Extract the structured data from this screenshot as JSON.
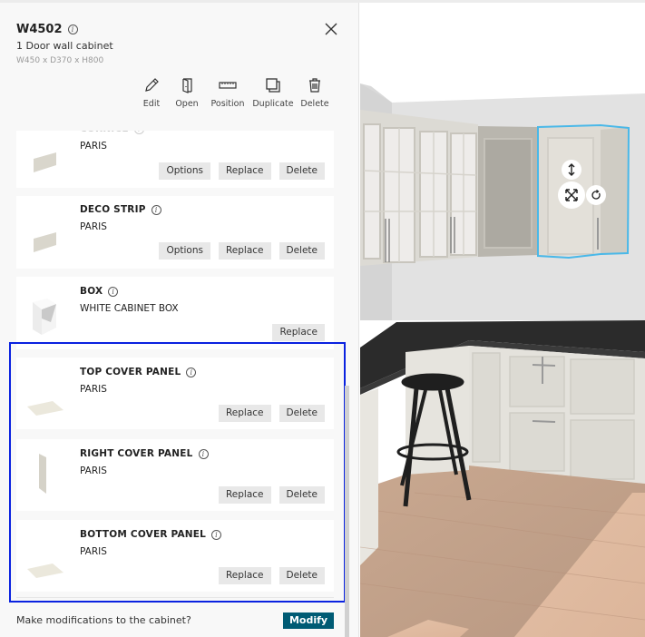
{
  "panel": {
    "title": "W4502",
    "subtitle": "1 Door wall cabinet",
    "dimensions": "W450 x D370 x H800",
    "actions": [
      {
        "label": "Edit",
        "icon": "pencil-icon"
      },
      {
        "label": "Open",
        "icon": "door-icon"
      },
      {
        "label": "Position",
        "icon": "ruler-icon"
      },
      {
        "label": "Duplicate",
        "icon": "duplicate-icon"
      },
      {
        "label": "Delete",
        "icon": "trash-icon"
      }
    ]
  },
  "components": [
    {
      "title": "CORNICE",
      "subtitle": "PARIS",
      "buttons": [
        "Options",
        "Replace",
        "Delete"
      ],
      "thumbnail": "strip"
    },
    {
      "title": "DECO STRIP",
      "subtitle": "PARIS",
      "buttons": [
        "Options",
        "Replace",
        "Delete"
      ],
      "thumbnail": "strip"
    },
    {
      "title": "BOX",
      "subtitle": "WHITE CABINET BOX",
      "buttons": [
        "Replace"
      ],
      "thumbnail": "box"
    },
    {
      "title": "TOP COVER PANEL",
      "subtitle": "PARIS",
      "buttons": [
        "Replace",
        "Delete"
      ],
      "thumbnail": "flat-panel"
    },
    {
      "title": "RIGHT COVER PANEL",
      "subtitle": "PARIS",
      "buttons": [
        "Replace",
        "Delete"
      ],
      "thumbnail": "side-panel"
    },
    {
      "title": "BOTTOM COVER PANEL",
      "subtitle": "PARIS",
      "buttons": [
        "Replace",
        "Delete"
      ],
      "thumbnail": "flat-panel"
    }
  ],
  "footer": {
    "question": "Make modifications to the cabinet?",
    "modify_label": "Modify"
  },
  "colors": {
    "accent": "#005b74",
    "selection_highlight": "#0a22e0",
    "selected_cabinet_outline": "#4ab8e8"
  },
  "scene": {
    "gizmos": [
      "move-vertical-icon",
      "resize-icon",
      "rotate-icon"
    ]
  }
}
